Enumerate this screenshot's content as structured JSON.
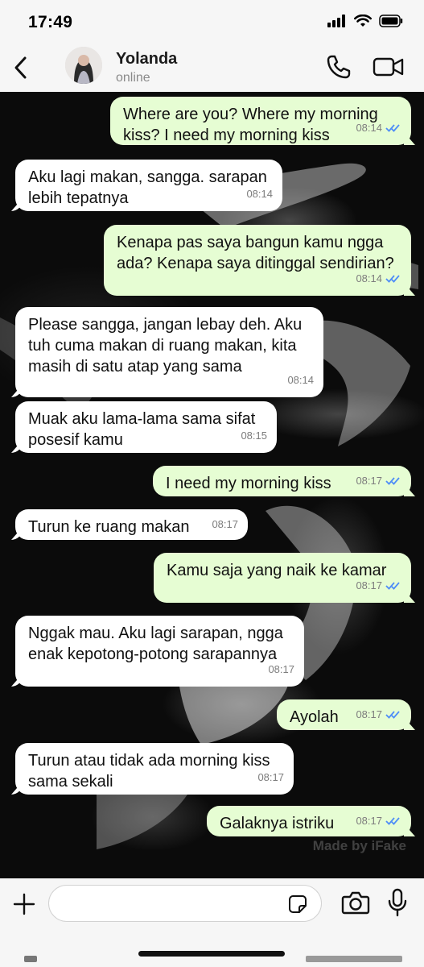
{
  "status_bar": {
    "time": "17:49"
  },
  "header": {
    "contact_name": "Yolanda",
    "contact_status": "online",
    "icons": [
      "back-chevron-icon",
      "phone-icon",
      "video-camera-icon"
    ]
  },
  "messages": [
    {
      "direction": "out",
      "text": "Where are you? Where my morning kiss? I need my morning kiss",
      "time": "08:14",
      "status": "read"
    },
    {
      "direction": "in",
      "text": "Aku lagi makan, sangga. sarapan lebih tepatnya",
      "time": "08:14"
    },
    {
      "direction": "out",
      "text": "Kenapa pas saya bangun kamu ngga ada? Kenapa saya ditinggal sendirian?",
      "time": "08:14",
      "status": "read"
    },
    {
      "direction": "in",
      "text": "Please sangga, jangan lebay deh. Aku tuh cuma makan di ruang makan, kita masih di satu atap yang sama",
      "time": "08:14"
    },
    {
      "direction": "in",
      "text": "Muak aku lama-lama sama sifat posesif kamu",
      "time": "08:15"
    },
    {
      "direction": "out",
      "text": "I need my morning kiss",
      "time": "08:17",
      "status": "read"
    },
    {
      "direction": "in",
      "text": "Turun ke ruang makan",
      "time": "08:17"
    },
    {
      "direction": "out",
      "text": "Kamu saja yang naik ke kamar",
      "time": "08:17",
      "status": "read"
    },
    {
      "direction": "in",
      "text": "Nggak mau. Aku lagi sarapan, ngga enak kepotong-potong sarapannya",
      "time": "08:17"
    },
    {
      "direction": "out",
      "text": "Ayolah",
      "time": "08:17",
      "status": "read"
    },
    {
      "direction": "in",
      "text": "Turun atau tidak ada morning kiss sama sekali",
      "time": "08:17"
    },
    {
      "direction": "out",
      "text": "Galaknya istriku",
      "time": "08:17",
      "status": "read"
    }
  ],
  "watermark": "Made by iFake",
  "input_bar": {
    "placeholder": "",
    "icons": [
      "plus-icon",
      "sticker-icon",
      "camera-icon",
      "microphone-icon"
    ]
  },
  "colors": {
    "outgoing_bubble": "#e6fdd3",
    "incoming_bubble": "#ffffff",
    "read_tick": "#4f8ef7",
    "chrome_background": "#f6f6f6"
  }
}
